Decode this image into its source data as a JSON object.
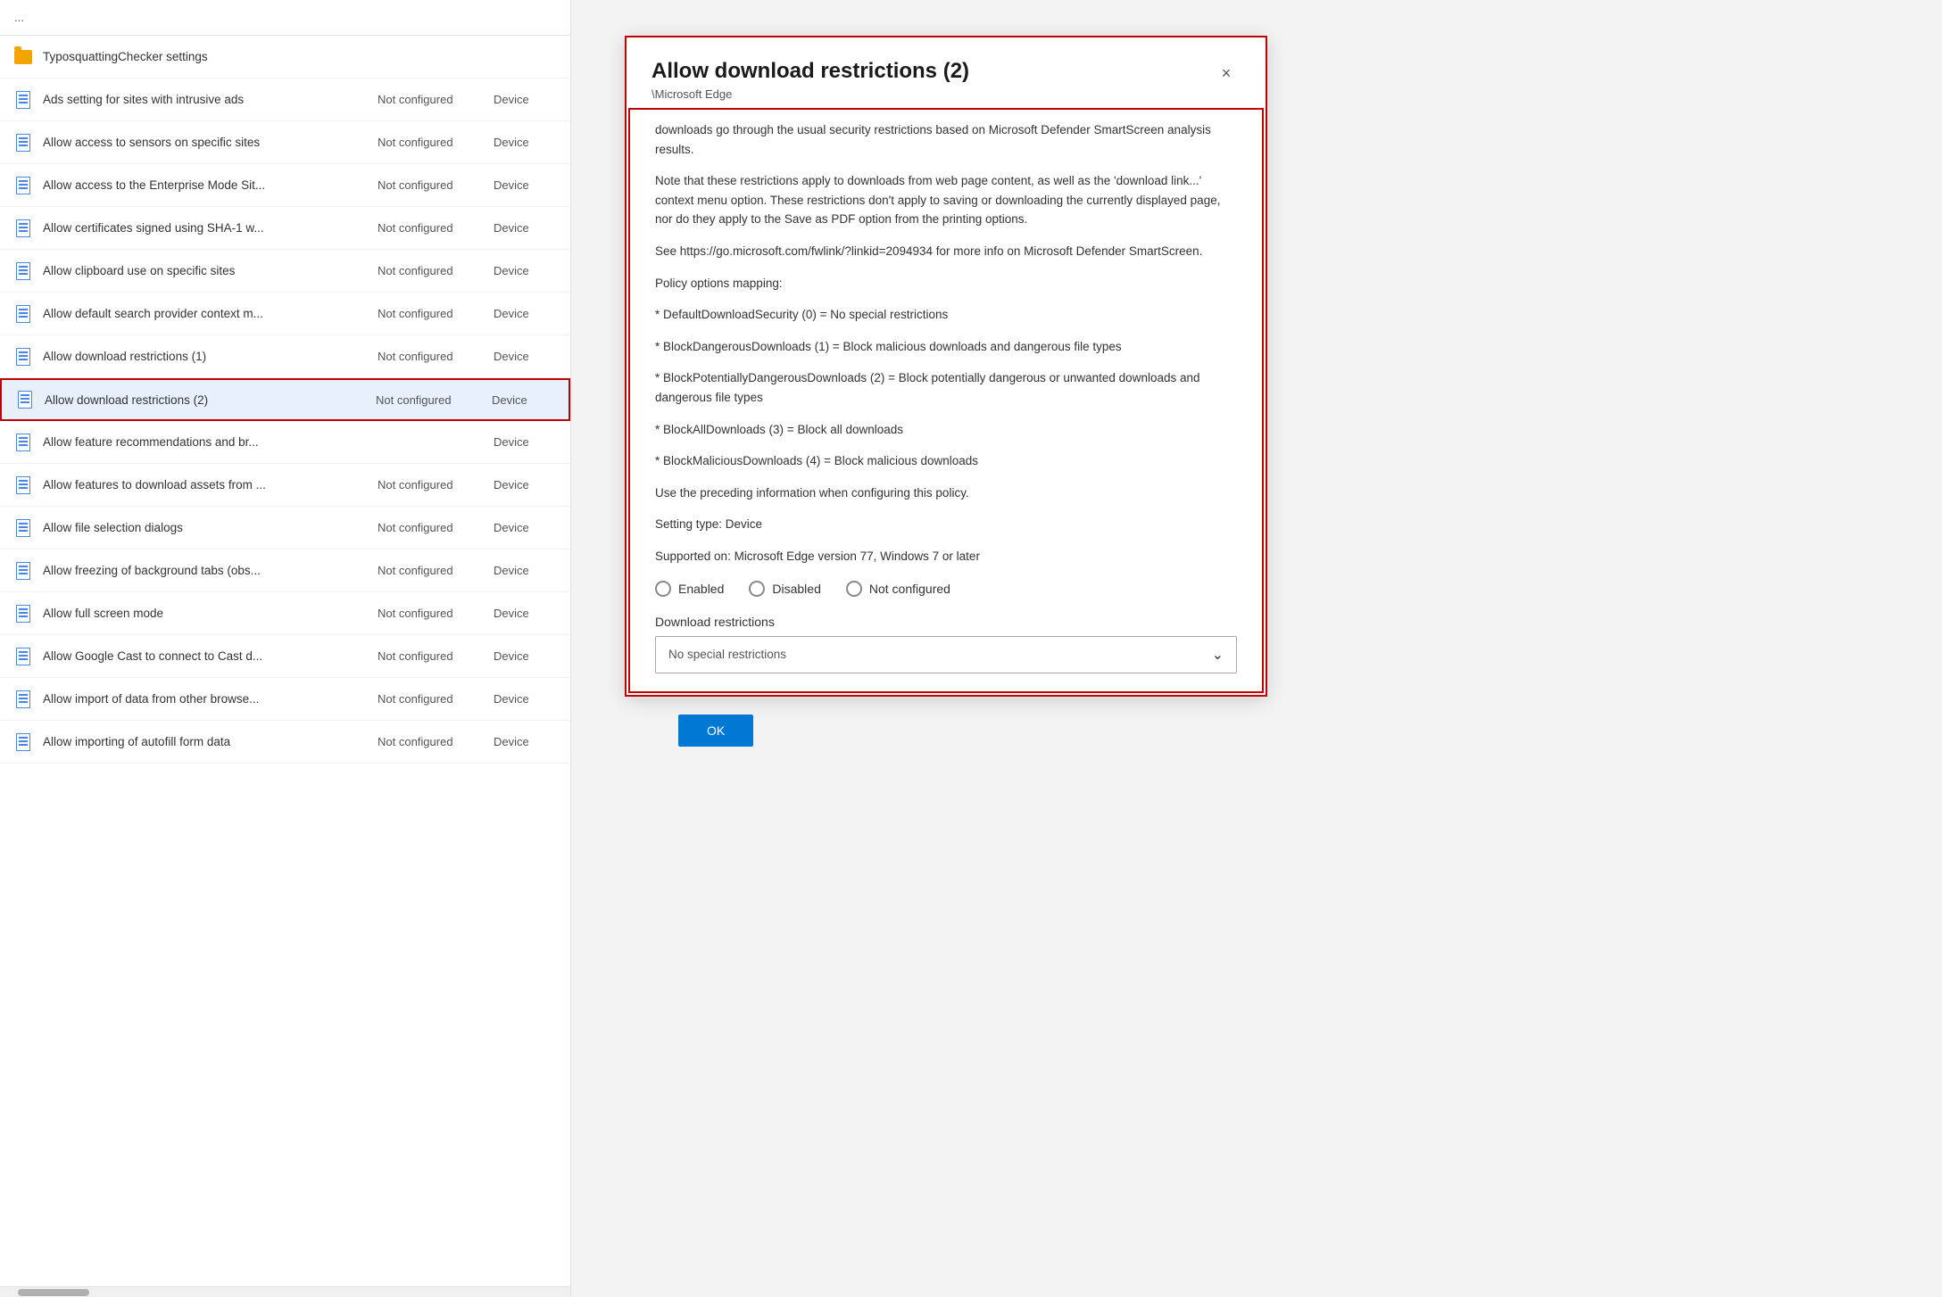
{
  "leftPanel": {
    "topText": "...",
    "items": [
      {
        "type": "folder",
        "name": "TyposquattingChecker settings",
        "status": "",
        "itemType": ""
      },
      {
        "type": "doc",
        "name": "Ads setting for sites with intrusive ads",
        "status": "Not configured",
        "itemType": "Device"
      },
      {
        "type": "doc",
        "name": "Allow access to sensors on specific sites",
        "status": "Not configured",
        "itemType": "Device"
      },
      {
        "type": "doc",
        "name": "Allow access to the Enterprise Mode Sit...",
        "status": "Not configured",
        "itemType": "Device"
      },
      {
        "type": "doc",
        "name": "Allow certificates signed using SHA-1 w...",
        "status": "Not configured",
        "itemType": "Device"
      },
      {
        "type": "doc",
        "name": "Allow clipboard use on specific sites",
        "status": "Not configured",
        "itemType": "Device"
      },
      {
        "type": "doc",
        "name": "Allow default search provider context m...",
        "status": "Not configured",
        "itemType": "Device"
      },
      {
        "type": "doc",
        "name": "Allow download restrictions (1)",
        "status": "Not configured",
        "itemType": "Device"
      },
      {
        "type": "doc",
        "name": "Allow download restrictions (2)",
        "status": "Not configured",
        "itemType": "Device",
        "selected": true
      },
      {
        "type": "doc",
        "name": "Allow feature recommendations and br...",
        "status": "",
        "itemType": "Device"
      },
      {
        "type": "doc",
        "name": "Allow features to download assets from ...",
        "status": "Not configured",
        "itemType": "Device"
      },
      {
        "type": "doc",
        "name": "Allow file selection dialogs",
        "status": "Not configured",
        "itemType": "Device"
      },
      {
        "type": "doc",
        "name": "Allow freezing of background tabs (obs...",
        "status": "Not configured",
        "itemType": "Device"
      },
      {
        "type": "doc",
        "name": "Allow full screen mode",
        "status": "Not configured",
        "itemType": "Device"
      },
      {
        "type": "doc",
        "name": "Allow Google Cast to connect to Cast d...",
        "status": "Not configured",
        "itemType": "Device"
      },
      {
        "type": "doc",
        "name": "Allow import of data from other browse...",
        "status": "Not configured",
        "itemType": "Device"
      },
      {
        "type": "doc",
        "name": "Allow importing of autofill form data",
        "status": "Not configured",
        "itemType": "Device"
      }
    ]
  },
  "dialog": {
    "title": "Allow download restrictions (2)",
    "breadcrumb": "\\Microsoft Edge",
    "closeLabel": "×",
    "descriptionParagraphs": [
      "downloads go through the usual security restrictions based on Microsoft Defender SmartScreen analysis results.",
      "Note that these restrictions apply to downloads from web page content, as well as the 'download link...' context menu option. These restrictions don't apply to saving or downloading the currently displayed page, nor do they apply to the Save as PDF option from the printing options.",
      "See https://go.microsoft.com/fwlink/?linkid=2094934 for more info on Microsoft Defender SmartScreen.",
      "Policy options mapping:",
      "* DefaultDownloadSecurity (0) = No special restrictions",
      "* BlockDangerousDownloads (1) = Block malicious downloads and dangerous file types",
      "* BlockPotentiallyDangerousDownloads (2) = Block potentially dangerous or unwanted downloads and dangerous file types",
      "* BlockAllDownloads (3) = Block all downloads",
      "* BlockMaliciousDownloads (4) = Block malicious downloads",
      "Use the preceding information when configuring this policy.",
      "Setting type: Device",
      "Supported on: Microsoft Edge version 77, Windows 7 or later"
    ],
    "radioOptions": [
      {
        "label": "Enabled",
        "selected": false
      },
      {
        "label": "Disabled",
        "selected": false
      },
      {
        "label": "Not configured",
        "selected": false
      }
    ],
    "dropdownLabel": "Download restrictions",
    "dropdownValue": "No special restrictions",
    "okButton": "OK"
  }
}
